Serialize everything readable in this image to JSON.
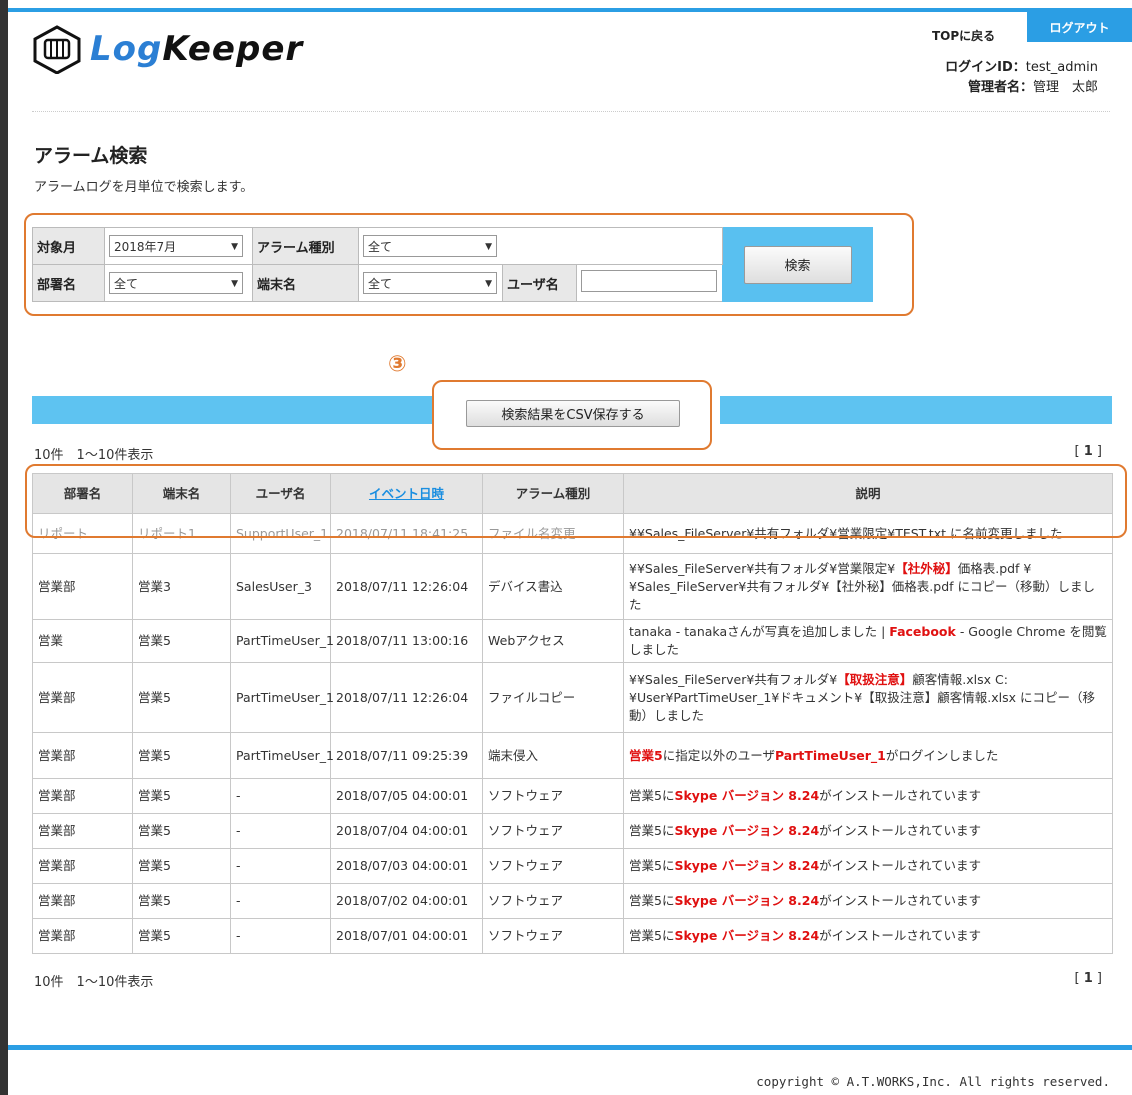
{
  "header": {
    "logo_text_1": "Log",
    "logo_text_2": "Keeper",
    "top_link": "TOPに戻る",
    "logout": "ログアウト",
    "login_id_label": "ログインID：",
    "login_id": "test_admin",
    "admin_label": "管理者名：",
    "admin_name": "管理　太郎"
  },
  "page": {
    "title": "アラーム検索",
    "description": "アラームログを月単位で検索します。"
  },
  "form": {
    "month_label": "対象月",
    "month_value": "2018年7月",
    "alarm_type_label": "アラーム種別",
    "alarm_type_value": "全て",
    "dept_label": "部署名",
    "dept_value": "全て",
    "terminal_label": "端末名",
    "terminal_value": "全て",
    "user_label": "ユーザ名",
    "user_value": "",
    "search_button": "検索"
  },
  "annotation_number": "③",
  "csv_button": "検索結果をCSV保存する",
  "count_text": "10件　1～10件表示",
  "pager_open": "[",
  "pager_page": "1",
  "pager_close": "]",
  "table": {
    "headers": [
      "部署名",
      "端末名",
      "ユーザ名",
      "イベント日時",
      "アラーム種別",
      "説明"
    ],
    "partial_row": {
      "dept": "リポート",
      "terminal": "リポート1",
      "user": "SupportUser_1",
      "datetime": "2018/07/11 18:41:25",
      "type": "ファイル名変更",
      "desc": "¥¥Sales_FileServer¥共有フォルダ¥営業限定¥TEST.txt に名前変更しました"
    },
    "rows": [
      {
        "dept": "営業部",
        "terminal": "営業3",
        "user": "SalesUser_3",
        "datetime": "2018/07/11 12:26:04",
        "type": "デバイス書込",
        "desc_a": "¥¥Sales_FileServer¥共有フォルダ¥営業限定¥",
        "desc_b": "【社外秘】",
        "desc_c": "価格表.pdf ¥¥Sales_FileServer¥共有フォルダ¥【社外秘】価格表.pdf にコピー（移動）しました"
      },
      {
        "dept": "営業",
        "terminal": "営業5",
        "user": "PartTimeUser_1",
        "datetime": "2018/07/11 13:00:16",
        "type": "Webアクセス",
        "desc_a": "tanaka - tanakaさんが写真を追加しました | ",
        "desc_b": "Facebook",
        "desc_c": " - Google Chrome を閲覧しました"
      },
      {
        "dept": "営業部",
        "terminal": "営業5",
        "user": "PartTimeUser_1",
        "datetime": "2018/07/11 12:26:04",
        "type": "ファイルコピー",
        "desc_a": "¥¥Sales_FileServer¥共有フォルダ¥",
        "desc_b": "【取扱注意】",
        "desc_c": "顧客情報.xlsx C:¥User¥PartTimeUser_1¥ドキュメント¥【取扱注意】顧客情報.xlsx にコピー（移動）しました"
      },
      {
        "dept": "営業部",
        "terminal": "営業5",
        "user": "PartTimeUser_1",
        "datetime": "2018/07/11 09:25:39",
        "type": "端末侵入",
        "desc_a": "",
        "desc_b": "営業5",
        "desc_c": "に指定以外のユーザ",
        "desc_d": "PartTimeUser_1",
        "desc_e": "がログインしました"
      },
      {
        "dept": "営業部",
        "terminal": "営業5",
        "user": "-",
        "datetime": "2018/07/05 04:00:01",
        "type": "ソフトウェア",
        "desc_a": "営業5に",
        "desc_b": "Skype バージョン 8.24",
        "desc_c": "がインストールされています"
      },
      {
        "dept": "営業部",
        "terminal": "営業5",
        "user": "-",
        "datetime": "2018/07/04 04:00:01",
        "type": "ソフトウェア",
        "desc_a": "営業5に",
        "desc_b": "Skype バージョン 8.24",
        "desc_c": "がインストールされています"
      },
      {
        "dept": "営業部",
        "terminal": "営業5",
        "user": "-",
        "datetime": "2018/07/03 04:00:01",
        "type": "ソフトウェア",
        "desc_a": "営業5に",
        "desc_b": "Skype バージョン 8.24",
        "desc_c": "がインストールされています"
      },
      {
        "dept": "営業部",
        "terminal": "営業5",
        "user": "-",
        "datetime": "2018/07/02 04:00:01",
        "type": "ソフトウェア",
        "desc_a": "営業5に",
        "desc_b": "Skype バージョン 8.24",
        "desc_c": "がインストールされています"
      },
      {
        "dept": "営業部",
        "terminal": "営業5",
        "user": "-",
        "datetime": "2018/07/01 04:00:01",
        "type": "ソフトウェア",
        "desc_a": "営業5に",
        "desc_b": "Skype バージョン 8.24",
        "desc_c": "がインストールされています"
      }
    ]
  },
  "footer": {
    "copyright": "copyright © A.T.WORKS,Inc. All rights reserved."
  },
  "colors": {
    "accent_blue": "#2b9ee4",
    "bar_blue": "#5ec3f1",
    "highlight_orange": "#e07a30",
    "alert_red": "#e01010"
  }
}
